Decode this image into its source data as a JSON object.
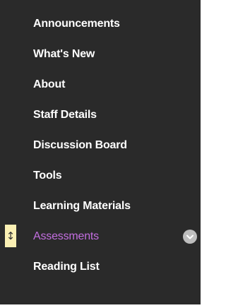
{
  "nav": {
    "items": [
      {
        "label": "Announcements"
      },
      {
        "label": "What's New"
      },
      {
        "label": "About"
      },
      {
        "label": "Staff Details"
      },
      {
        "label": "Discussion Board"
      },
      {
        "label": "Tools"
      },
      {
        "label": "Learning Materials"
      },
      {
        "label": "Assessments",
        "active": true
      },
      {
        "label": "Reading List"
      }
    ],
    "drag_handle_glyph": "↕"
  },
  "colors": {
    "sidebar_background": "#2a2a2a",
    "item_text": "#ffffff",
    "active_item_text": "#c36ee0",
    "drag_handle_background": "#fbf0b4",
    "menu_button_background": "#bdbdbd"
  }
}
